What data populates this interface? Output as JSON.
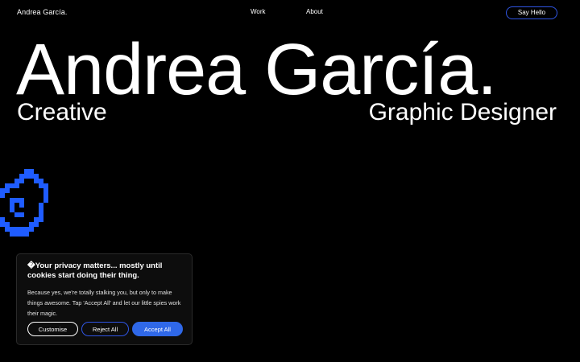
{
  "header": {
    "brand": "Andrea García.",
    "nav": [
      {
        "label": "Work"
      },
      {
        "label": "About"
      }
    ],
    "cta_label": "Say Hello"
  },
  "hero": {
    "name": "Andrea García.",
    "left_tagline": "Creative",
    "right_tagline": "Graphic Designer"
  },
  "cookie_banner": {
    "title": "�Your privacy matters... mostly until cookies start doing their thing.",
    "body": "Because yes, we're totally stalking you, but only to make things awesome. Tap 'Accept All' and let our little spies work their magic.",
    "buttons": {
      "customise": "Customise",
      "reject": "Reject All",
      "accept": "Accept All"
    }
  },
  "colors": {
    "background": "#000000",
    "accent": "#2f68e8",
    "pixel_art": "#1f5cff"
  },
  "icons": {
    "pixel_art": "pixel-smiley-icon"
  }
}
